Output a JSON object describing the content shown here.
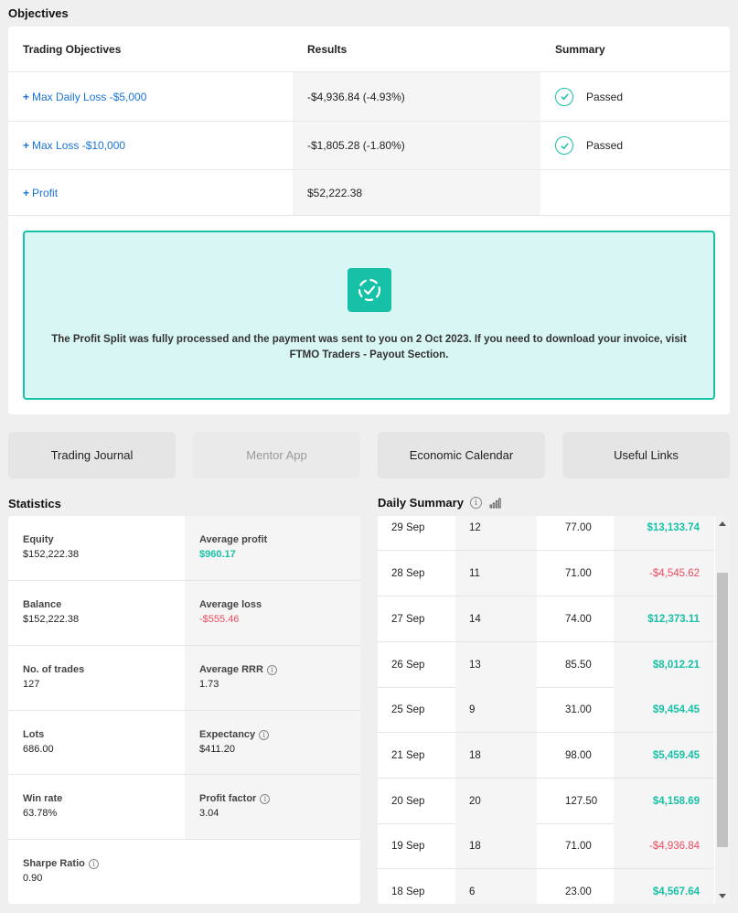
{
  "objectives": {
    "title": "Objectives",
    "headers": {
      "objective": "Trading Objectives",
      "results": "Results",
      "summary": "Summary"
    },
    "rows": [
      {
        "name": "Max Daily Loss -$5,000",
        "result": "-$4,936.84 (-4.93%)",
        "summary": "Passed"
      },
      {
        "name": "Max Loss -$10,000",
        "result": "-$1,805.28 (-1.80%)",
        "summary": "Passed"
      },
      {
        "name": "Profit",
        "result": "$52,222.38",
        "summary": ""
      }
    ],
    "plus": "+",
    "notice": "The Profit Split was fully processed and the payment was sent to you on 2 Oct 2023. If you need to download your invoice, visit FTMO Traders - Payout Section."
  },
  "buttons": {
    "trading_journal": "Trading Journal",
    "mentor_app": "Mentor App",
    "economic_calendar": "Economic Calendar",
    "useful_links": "Useful Links"
  },
  "statistics": {
    "title": "Statistics",
    "equity": {
      "label": "Equity",
      "value": "$152,222.38"
    },
    "average_profit": {
      "label": "Average profit",
      "value": "$960.17"
    },
    "balance": {
      "label": "Balance",
      "value": "$152,222.38"
    },
    "average_loss": {
      "label": "Average loss",
      "value": "-$555.46"
    },
    "trades": {
      "label": "No. of trades",
      "value": "127"
    },
    "average_rrr": {
      "label": "Average RRR",
      "value": "1.73"
    },
    "lots": {
      "label": "Lots",
      "value": "686.00"
    },
    "expectancy": {
      "label": "Expectancy",
      "value": "$411.20"
    },
    "win_rate": {
      "label": "Win rate",
      "value": "63.78%"
    },
    "profit_factor": {
      "label": "Profit factor",
      "value": "3.04"
    },
    "sharpe_ratio": {
      "label": "Sharpe Ratio",
      "value": "0.90"
    },
    "info_glyph": "i"
  },
  "daily_summary": {
    "title": "Daily Summary",
    "info_glyph": "i",
    "rows": [
      {
        "date": "29 Sep",
        "trades": "12",
        "lots": "77.00",
        "profit": "$13,133.74",
        "positive": true
      },
      {
        "date": "28 Sep",
        "trades": "11",
        "lots": "71.00",
        "profit": "-$4,545.62",
        "positive": false
      },
      {
        "date": "27 Sep",
        "trades": "14",
        "lots": "74.00",
        "profit": "$12,373.11",
        "positive": true
      },
      {
        "date": "26 Sep",
        "trades": "13",
        "lots": "85.50",
        "profit": "$8,012.21",
        "positive": true
      },
      {
        "date": "25 Sep",
        "trades": "9",
        "lots": "31.00",
        "profit": "$9,454.45",
        "positive": true
      },
      {
        "date": "21 Sep",
        "trades": "18",
        "lots": "98.00",
        "profit": "$5,459.45",
        "positive": true
      },
      {
        "date": "20 Sep",
        "trades": "20",
        "lots": "127.50",
        "profit": "$4,158.69",
        "positive": true
      },
      {
        "date": "19 Sep",
        "trades": "18",
        "lots": "71.00",
        "profit": "-$4,936.84",
        "positive": false
      },
      {
        "date": "18 Sep",
        "trades": "6",
        "lots": "23.00",
        "profit": "$4,567.64",
        "positive": true
      }
    ]
  },
  "colors": {
    "accent": "#17c1a7",
    "link": "#1a73d9",
    "negative": "#ef4b5e",
    "notice_bg": "#d8f6f3"
  }
}
